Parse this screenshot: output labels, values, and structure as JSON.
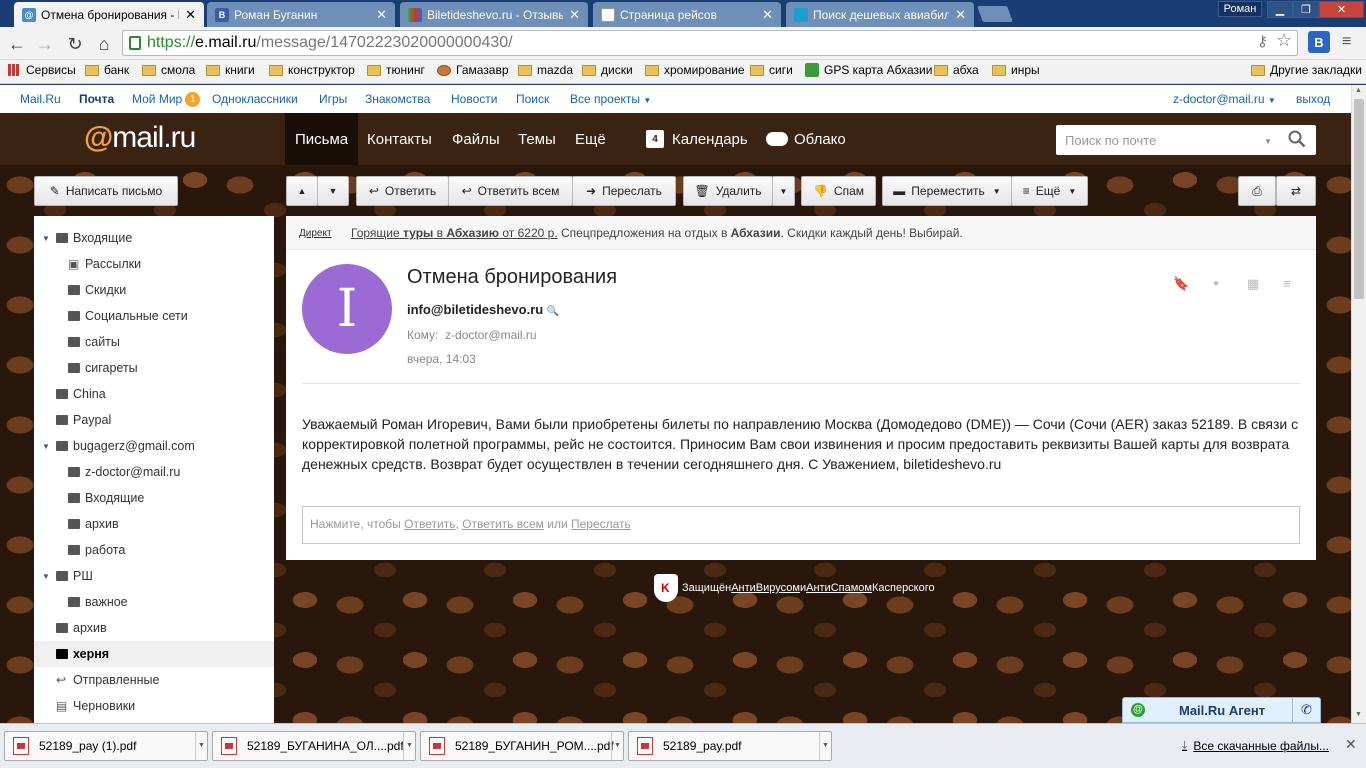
{
  "browser": {
    "tabs": [
      {
        "title": "Отмена бронирования - По",
        "favicon": "@",
        "active": true,
        "color": "#4a8bc9"
      },
      {
        "title": "Роман Буганин",
        "favicon": "B",
        "active": false,
        "color": "#3b5ba9"
      },
      {
        "title": "Biletideshevo.ru - Отзывы о",
        "favicon": "",
        "active": false,
        "color": "#3aaa3a"
      },
      {
        "title": "Страница рейсов",
        "favicon": "",
        "active": false,
        "color": "#fff"
      },
      {
        "title": "Поиск дешевых авиабилет",
        "favicon": "",
        "active": false,
        "color": "#1aa0d0"
      }
    ],
    "user": "Роман",
    "url": {
      "proto": "https://",
      "host": "e.mail.ru",
      "path": "/message/14702223020000000430/"
    },
    "extension_label": "B"
  },
  "bookmarks": {
    "apps": "Сервисы",
    "items": [
      "банк",
      "смола",
      "книги",
      "конструктор",
      "тюнинг",
      "Гамазавр",
      "mazda",
      "диски",
      "хромирование",
      "сиги",
      "GPS карта Абхазии",
      "абха",
      "инры"
    ],
    "other": "Другие закладки"
  },
  "portal": {
    "links": [
      "Mail.Ru",
      "Почта",
      "Мой Мир",
      "Одноклассники",
      "Игры",
      "Знакомства",
      "Новости",
      "Поиск",
      "Все проекты"
    ],
    "moi_mir_badge": "1",
    "account": "z-doctor@mail.ru",
    "logout": "выход"
  },
  "header": {
    "logo_at": "@",
    "logo_text": "mail.ru",
    "nav": [
      "Письма",
      "Контакты",
      "Файлы",
      "Темы",
      "Ещё"
    ],
    "calendar_day": "4",
    "calendar": "Календарь",
    "cloud": "Облако",
    "search_placeholder": "Поиск по почте"
  },
  "toolbar": {
    "compose": "Написать письмо",
    "reply": "Ответить",
    "reply_all": "Ответить всем",
    "forward": "Переслать",
    "delete": "Удалить",
    "spam": "Спам",
    "move": "Переместить",
    "more": "Ещё"
  },
  "folders": [
    {
      "label": "Входящие",
      "icon": "envelope-icon",
      "level": 0,
      "expander": true,
      "selected": false
    },
    {
      "label": "Рассылки",
      "icon": "newsletter-icon",
      "level": 1,
      "expander": false,
      "selected": false
    },
    {
      "label": "Скидки",
      "icon": "folder-icon",
      "level": 1,
      "expander": false,
      "selected": false
    },
    {
      "label": "Социальные сети",
      "icon": "folder-icon",
      "level": 1,
      "expander": false,
      "selected": false
    },
    {
      "label": "сайты",
      "icon": "folder-icon",
      "level": 1,
      "expander": false,
      "selected": false
    },
    {
      "label": "сигареты",
      "icon": "folder-icon",
      "level": 1,
      "expander": false,
      "selected": false
    },
    {
      "label": "China",
      "icon": "folder-icon",
      "level": 0,
      "expander": false,
      "selected": false
    },
    {
      "label": "Paypal",
      "icon": "folder-icon",
      "level": 0,
      "expander": false,
      "selected": false
    },
    {
      "label": "bugagerz@gmail.com",
      "icon": "envelope-icon",
      "level": 0,
      "expander": true,
      "selected": false
    },
    {
      "label": "z-doctor@mail.ru",
      "icon": "folder-icon",
      "level": 1,
      "expander": false,
      "selected": false
    },
    {
      "label": "Входящие",
      "icon": "folder-icon",
      "level": 1,
      "expander": false,
      "selected": false
    },
    {
      "label": "архив",
      "icon": "folder-icon",
      "level": 1,
      "expander": false,
      "selected": false
    },
    {
      "label": "работа",
      "icon": "folder-icon",
      "level": 1,
      "expander": false,
      "selected": false
    },
    {
      "label": "РШ",
      "icon": "folder-icon",
      "level": 0,
      "expander": true,
      "selected": false
    },
    {
      "label": "важное",
      "icon": "folder-icon",
      "level": 1,
      "expander": false,
      "selected": false
    },
    {
      "label": "архив",
      "icon": "folder-icon",
      "level": 0,
      "expander": false,
      "selected": false
    },
    {
      "label": "херня",
      "icon": "folder-icon",
      "level": 0,
      "expander": false,
      "selected": true
    },
    {
      "label": "Отправленные",
      "icon": "sent-icon",
      "level": 0,
      "expander": false,
      "selected": false
    },
    {
      "label": "Черновики",
      "icon": "draft-icon",
      "level": 0,
      "expander": false,
      "selected": false
    }
  ],
  "ad": {
    "direct": "Директ",
    "link_pre": "Горящие ",
    "link_b1": "туры",
    "link_mid": " в ",
    "link_b2": "Абхазию",
    "link_post": " от 6220 р.",
    "text_pre": " Спецпредложения на отдых в ",
    "text_b": "Абхазии",
    "text_post": ". Скидки каждый день! Выбирай."
  },
  "message": {
    "avatar_letter": "I",
    "avatar_color": "#9b6ad5",
    "subject": "Отмена бронирования",
    "from": "info@biletideshevo.ru",
    "to_label": "Кому:",
    "to": "z-doctor@mail.ru",
    "date": "вчера, 14:03",
    "body": "Уважаемый Роман Игоревич, Вами были приобретены билеты по направлению Москва (Домодедово (DME)) — Сочи (Сочи (AER) заказ 52189. В связи с корректировкой полетной программы, рейс не состоится. Приносим Вам свои извинения и просим предоставить реквизиты Вашей карты для возврата денежных средств. Возврат будет осуществлен в течении сегодняшнего дня. С Уважением, biletideshevo.ru",
    "reply_prefix": "Нажмите, чтобы ",
    "reply_link": "Ответить",
    "reply_sep": ", ",
    "reply_all_link": "Ответить всем",
    "reply_or": " или ",
    "forward_link": "Переслать"
  },
  "kaspersky": {
    "pre": "Защищён ",
    "antivirus": "АнтиВирусом",
    "and": " и ",
    "antispam": "АнтиСпамом",
    "post": " Касперского"
  },
  "agent": {
    "label": "Mail.Ru Агент"
  },
  "downloads": {
    "files": [
      "52189_pay (1).pdf",
      "52189_БУГАНИНА_ОЛ....pdf",
      "52189_БУГАНИН_РОМ....pdf",
      "52189_pay.pdf"
    ],
    "all": "Все скачанные файлы..."
  }
}
